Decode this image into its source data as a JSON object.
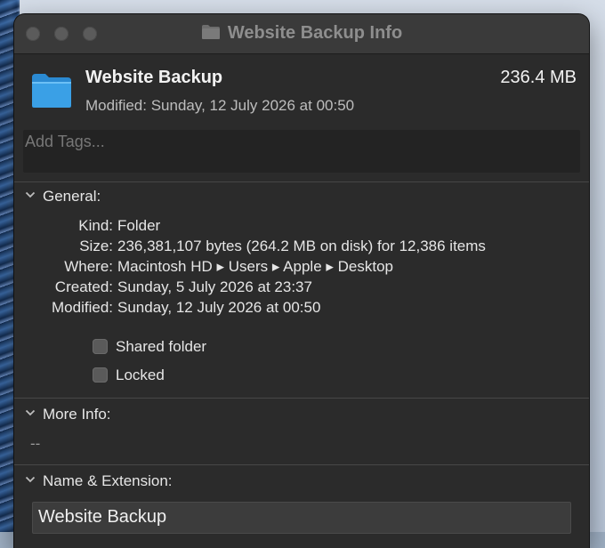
{
  "window": {
    "title": "Website Backup Info"
  },
  "header": {
    "name": "Website Backup",
    "size": "236.4 MB",
    "modified": "Modified: Sunday, 12 July 2026 at 00:50"
  },
  "tags": {
    "placeholder": "Add Tags..."
  },
  "general": {
    "heading": "General:",
    "kind_label": "Kind:",
    "kind_value": "Folder",
    "size_label": "Size:",
    "size_value": "236,381,107 bytes (264.2 MB on disk) for 12,386 items",
    "where_label": "Where:",
    "where_value": "Macintosh HD ▸ Users ▸ Apple ▸ Desktop",
    "created_label": "Created:",
    "created_value": "Sunday, 5 July 2026 at 23:37",
    "modified_label": "Modified:",
    "modified_value": "Sunday, 12 July 2026 at 00:50",
    "shared_label": "Shared folder",
    "locked_label": "Locked",
    "shared_checked": false,
    "locked_checked": false
  },
  "more_info": {
    "heading": "More Info:",
    "value": "--"
  },
  "name_ext": {
    "heading": "Name & Extension:",
    "value": "Website Backup"
  },
  "colors": {
    "window_bg": "#2b2b2b",
    "titlebar_bg": "#3a3a3a",
    "folder_blue": "#3aa0e6"
  },
  "icons": {
    "title_folder": "folder-icon",
    "header_folder": "folder-icon",
    "disclosure": "chevron-down-icon"
  }
}
